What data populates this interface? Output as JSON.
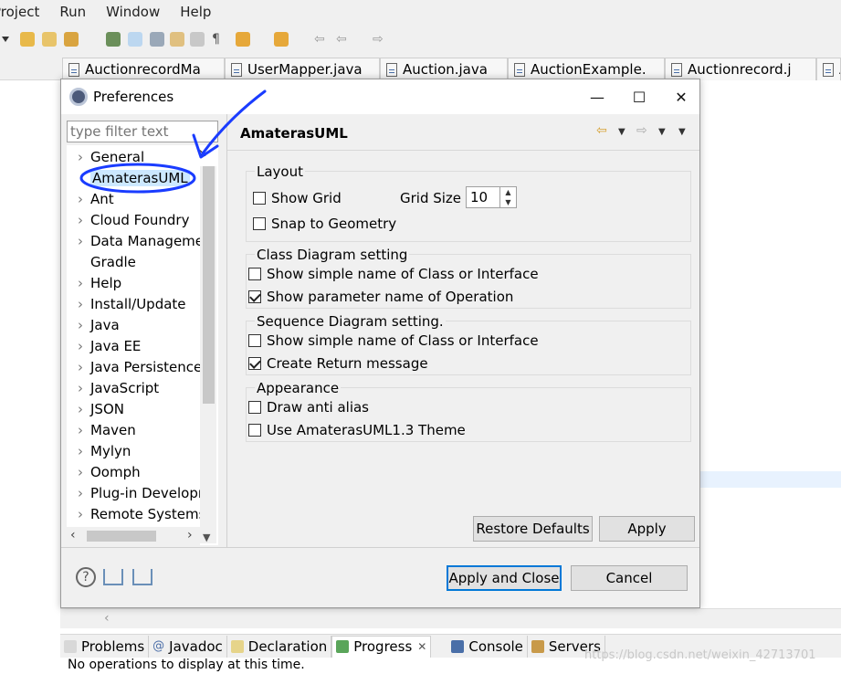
{
  "menu": [
    "Project",
    "Run",
    "Window",
    "Help"
  ],
  "editor_tabs": [
    "AuctionrecordMa",
    "UserMapper.java",
    "Auction.java",
    "AuctionExample.",
    "Auctionrecord.j",
    "A"
  ],
  "dialog": {
    "title": "Preferences",
    "window_buttons": {
      "minimize": "—",
      "maximize": "☐",
      "close": "✕"
    },
    "filter_placeholder": "type filter text",
    "tree": [
      {
        "label": "General",
        "expandable": true
      },
      {
        "label": "AmaterasUML",
        "expandable": false,
        "selected": true
      },
      {
        "label": "Ant",
        "expandable": true
      },
      {
        "label": "Cloud Foundry",
        "expandable": true
      },
      {
        "label": "Data Manageme",
        "expandable": true
      },
      {
        "label": "Gradle",
        "expandable": false
      },
      {
        "label": "Help",
        "expandable": true
      },
      {
        "label": "Install/Update",
        "expandable": true
      },
      {
        "label": "Java",
        "expandable": true
      },
      {
        "label": "Java EE",
        "expandable": true
      },
      {
        "label": "Java Persistence",
        "expandable": true
      },
      {
        "label": "JavaScript",
        "expandable": true
      },
      {
        "label": "JSON",
        "expandable": true
      },
      {
        "label": "Maven",
        "expandable": true
      },
      {
        "label": "Mylyn",
        "expandable": true
      },
      {
        "label": "Oomph",
        "expandable": true
      },
      {
        "label": "Plug-in Developr",
        "expandable": true
      },
      {
        "label": "Remote Systems",
        "expandable": true
      }
    ],
    "page_title": "AmaterasUML",
    "layout": {
      "label": "Layout",
      "show_grid": {
        "label": "Show Grid",
        "checked": false
      },
      "grid_size_label": "Grid Size",
      "grid_size_value": "10",
      "snap_to_geometry": {
        "label": "Snap to Geometry",
        "checked": false
      }
    },
    "class_diagram": {
      "label": "Class Diagram setting",
      "simple_name": {
        "label": "Show simple name of Class or Interface",
        "checked": false
      },
      "param_name": {
        "label": "Show parameter name of Operation",
        "checked": true
      }
    },
    "sequence_diagram": {
      "label": "Sequence Diagram setting.",
      "simple_name": {
        "label": "Show simple name of Class or Interface",
        "checked": false
      },
      "return_message": {
        "label": "Create Return message",
        "checked": true
      }
    },
    "appearance": {
      "label": "Appearance",
      "anti_alias": {
        "label": "Draw anti alias",
        "checked": false
      },
      "theme": {
        "label": "Use AmaterasUML1.3 Theme",
        "checked": false
      }
    },
    "buttons": {
      "restore_defaults": "Restore Defaults",
      "apply": "Apply",
      "apply_and_close": "Apply and Close",
      "cancel": "Cancel"
    }
  },
  "bottom_tabs": [
    "Problems",
    "Javadoc",
    "Declaration",
    "Progress",
    "Console",
    "Servers"
  ],
  "bottom_status": "No operations to display at this time.",
  "watermark": "https://blog.csdn.net/weixin_42713701",
  "colors": {
    "accent": "#0078d7",
    "selection": "#cce8ff",
    "annotation": "#1a3cff"
  }
}
